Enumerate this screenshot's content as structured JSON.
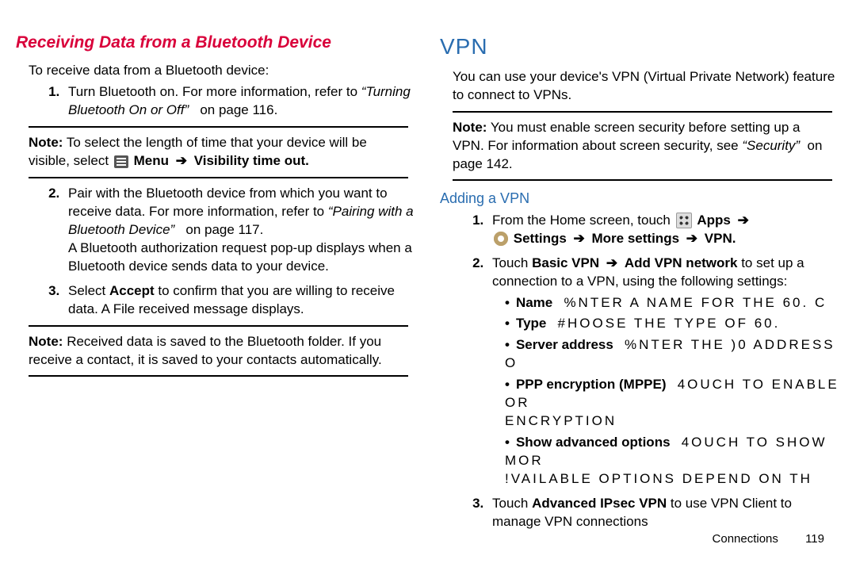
{
  "left": {
    "heading": "Receiving Data from a Bluetooth Device",
    "intro": "To receive data from a Bluetooth device:",
    "step1_a": "Turn Bluetooth on. For more information, refer to",
    "step1_xref": "“Turning Bluetooth On or Off”",
    "step1_page": "on page 116.",
    "note1_a": "To select the length of time that your device will be visible, select",
    "note1_menu": "Menu",
    "note1_vto": "Visibility time out",
    "step2_a": "Pair with the Bluetooth device from which you want to receive data. For more information, refer to",
    "step2_xref": "“Pairing with a Bluetooth Device”",
    "step2_page": "on page 117.",
    "step2_b": "A Bluetooth authorization request pop-up displays when a Bluetooth device sends data to your device.",
    "step3_a": "Select ",
    "step3_accept": "Accept",
    "step3_b": " to confirm that you are willing to receive data. A File received message displays.",
    "note2": "Received data is saved to the Bluetooth folder. If you receive a contact, it is saved to your contacts automatically."
  },
  "right": {
    "heading": "VPN",
    "intro": "You can use your device's VPN (Virtual Private Network) feature to connect to VPNs.",
    "note_a": "You must enable screen security before setting up a VPN. For information about screen security, see",
    "note_xref": "“Security”",
    "note_page": "on page 142.",
    "sub": "Adding a VPN",
    "s1_a": "From the Home screen, touch",
    "s1_apps": "Apps",
    "s1_settings": "Settings",
    "s1_more": "More settings",
    "s1_vpn": "VPN",
    "s2_a": "Touch ",
    "s2_basic": "Basic VPN",
    "s2_add": "Add VPN network",
    "s2_b": " to set up a connection to a VPN, using the following settings:",
    "bul_name_l": "Name",
    "bul_name_v": "%NTER A NAME FOR THE 60. C",
    "bul_type_l": "Type",
    "bul_type_v": "#HOOSE THE TYPE OF 60.",
    "bul_srv_l": "Server address",
    "bul_srv_v": "%NTER THE )0 ADDRESS O",
    "bul_ppp_l": "PPP encryption (MPPE)",
    "bul_ppp_v": "4OUCH TO ENABLE OR",
    "bul_ppp_v2": "ENCRYPTION",
    "bul_adv_l": "Show advanced options",
    "bul_adv_v": "4OUCH TO SHOW MOR",
    "bul_adv_v2": "!VAILABLE OPTIONS DEPEND ON TH",
    "s3_a": "Touch ",
    "s3_ipsec": "Advanced IPsec VPN",
    "s3_b": " to use VPN Client to manage VPN connections",
    "footer_section": "Connections",
    "footer_page": "119"
  },
  "labels": {
    "note": "Note:"
  },
  "glyphs": {
    "arrow": "➔"
  }
}
